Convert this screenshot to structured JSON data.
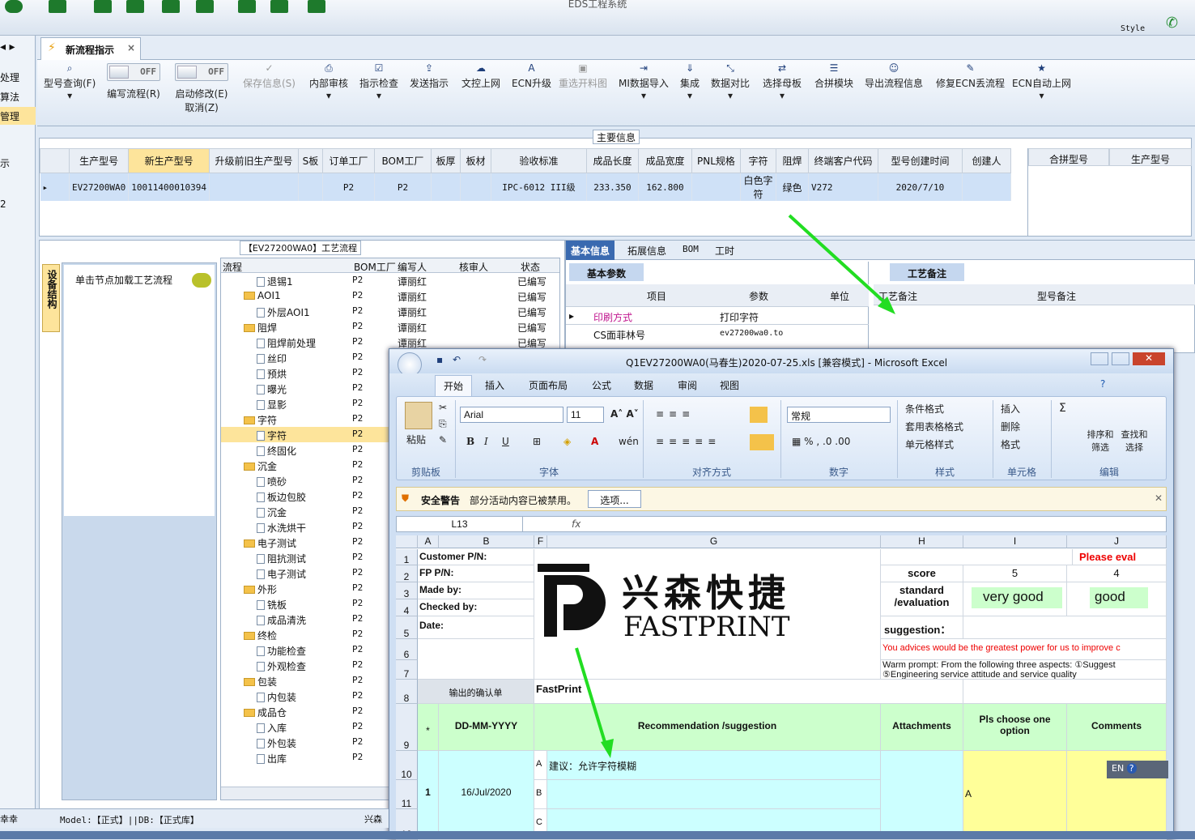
{
  "app": {
    "title": "EDS工程系统",
    "style_label": "Style"
  },
  "tab": {
    "label": "新流程指示",
    "close": "×"
  },
  "left_nav": [
    "处理",
    "算法",
    "管理",
    "示",
    "2"
  ],
  "ribbon": {
    "query": "型号查询(F)",
    "edit_flow": "编写流程(R)",
    "toggle_off": "OFF",
    "start_edit": "启动修改(E)",
    "cancel": "取消(Z)",
    "save": "保存信息(S)",
    "internal_review": "内部审核",
    "indicator_check": "指示检查",
    "send": "发送指示",
    "doc_upload": "文控上网",
    "ecn_upgrade": "ECN升级",
    "reselect": "重选开料图",
    "mi_import": "MI数据导入",
    "integrate": "集成",
    "compare": "数据对比",
    "select_mother": "选择母板",
    "merge_module": "合拼模块",
    "export_flow": "导出流程信息",
    "fix_ecn": "修复ECN丢流程",
    "ecn_auto": "ECN自动上网"
  },
  "main_info": {
    "title": "主要信息",
    "headers": [
      "生产型号",
      "新生产型号",
      "升级前旧生产型号",
      "S板",
      "订单工厂",
      "BOM工厂",
      "板厚",
      "板材",
      "验收标准",
      "成品长度",
      "成品宽度",
      "PNL规格",
      "字符",
      "阻焊",
      "终端客户代码",
      "型号创建时间",
      "创建人"
    ],
    "row": {
      "prod": "EV27200WA0",
      "new": "10011400010394",
      "order_factory": "P2",
      "bom": "P2",
      "standard": "IPC-6012 III级",
      "length": "233.350",
      "width": "162.800",
      "char": "白色字符",
      "solder": "绿色",
      "customer": "V272",
      "created": "2020/7/10"
    },
    "side_headers": [
      "合拼型号",
      "生产型号"
    ]
  },
  "process": {
    "title": "【EV27200WA0】工艺流程",
    "vtab": "设备结构",
    "node_hint": "单击节点加载工艺流程",
    "headers": [
      "流程",
      "BOM工厂",
      "编写人",
      "核审人",
      "状态"
    ],
    "rows": [
      {
        "n": "退锡1",
        "t": "doc",
        "l": 2,
        "b": "P2",
        "w": "谭丽红",
        "s": "已编写"
      },
      {
        "n": "AOI1",
        "t": "fold",
        "l": 1,
        "b": "P2",
        "w": "谭丽红",
        "s": "已编写"
      },
      {
        "n": "外层AOI1",
        "t": "doc",
        "l": 2,
        "b": "P2",
        "w": "谭丽红",
        "s": "已编写"
      },
      {
        "n": "阻焊",
        "t": "fold",
        "l": 1,
        "b": "P2",
        "w": "谭丽红",
        "s": "已编写"
      },
      {
        "n": "阻焊前处理",
        "t": "doc",
        "l": 2,
        "b": "P2",
        "w": "谭丽红",
        "s": "已编写"
      },
      {
        "n": "丝印",
        "t": "doc",
        "l": 2,
        "b": "P2",
        "w": "",
        "s": ""
      },
      {
        "n": "预烘",
        "t": "doc",
        "l": 2,
        "b": "P2",
        "w": "",
        "s": ""
      },
      {
        "n": "曝光",
        "t": "doc",
        "l": 2,
        "b": "P2",
        "w": "",
        "s": ""
      },
      {
        "n": "显影",
        "t": "doc",
        "l": 2,
        "b": "P2",
        "w": "",
        "s": ""
      },
      {
        "n": "字符",
        "t": "fold",
        "l": 1,
        "b": "P2",
        "w": "",
        "s": ""
      },
      {
        "n": "字符",
        "t": "doc",
        "l": 2,
        "b": "P2",
        "w": "",
        "s": "",
        "sel": true
      },
      {
        "n": "终固化",
        "t": "doc",
        "l": 2,
        "b": "P2",
        "w": "",
        "s": ""
      },
      {
        "n": "沉金",
        "t": "fold",
        "l": 1,
        "b": "P2",
        "w": "",
        "s": ""
      },
      {
        "n": "喷砂",
        "t": "doc",
        "l": 2,
        "b": "P2",
        "w": "",
        "s": ""
      },
      {
        "n": "板边包胶",
        "t": "doc",
        "l": 2,
        "b": "P2",
        "w": "",
        "s": ""
      },
      {
        "n": "沉金",
        "t": "doc",
        "l": 2,
        "b": "P2",
        "w": "",
        "s": ""
      },
      {
        "n": "水洗烘干",
        "t": "doc",
        "l": 2,
        "b": "P2",
        "w": "",
        "s": ""
      },
      {
        "n": "电子测试",
        "t": "fold",
        "l": 1,
        "b": "P2",
        "w": "",
        "s": ""
      },
      {
        "n": "阻抗测试",
        "t": "doc",
        "l": 2,
        "b": "P2",
        "w": "",
        "s": ""
      },
      {
        "n": "电子测试",
        "t": "doc",
        "l": 2,
        "b": "P2",
        "w": "",
        "s": ""
      },
      {
        "n": "外形",
        "t": "fold",
        "l": 1,
        "b": "P2",
        "w": "",
        "s": ""
      },
      {
        "n": "铣板",
        "t": "doc",
        "l": 2,
        "b": "P2",
        "w": "",
        "s": ""
      },
      {
        "n": "成品清洗",
        "t": "doc",
        "l": 2,
        "b": "P2",
        "w": "",
        "s": ""
      },
      {
        "n": "终检",
        "t": "fold",
        "l": 1,
        "b": "P2",
        "w": "",
        "s": ""
      },
      {
        "n": "功能检查",
        "t": "doc",
        "l": 2,
        "b": "P2",
        "w": "",
        "s": ""
      },
      {
        "n": "外观检查",
        "t": "doc",
        "l": 2,
        "b": "P2",
        "w": "",
        "s": ""
      },
      {
        "n": "包装",
        "t": "fold",
        "l": 1,
        "b": "P2",
        "w": "",
        "s": ""
      },
      {
        "n": "内包装",
        "t": "doc",
        "l": 2,
        "b": "P2",
        "w": "",
        "s": ""
      },
      {
        "n": "成品仓",
        "t": "fold",
        "l": 1,
        "b": "P2",
        "w": "",
        "s": ""
      },
      {
        "n": "入库",
        "t": "doc",
        "l": 2,
        "b": "P2",
        "w": "",
        "s": ""
      },
      {
        "n": "外包装",
        "t": "doc",
        "l": 2,
        "b": "P2",
        "w": "",
        "s": ""
      },
      {
        "n": "出库",
        "t": "doc",
        "l": 2,
        "b": "P2",
        "w": "",
        "s": ""
      }
    ]
  },
  "right_panel": {
    "tabs": [
      "基本信息",
      "拓展信息",
      "BOM",
      "工时"
    ],
    "basic_params": "基本参数",
    "craft_note": "工艺备注",
    "headers": [
      "项目",
      "参数",
      "单位"
    ],
    "rows": [
      [
        "印刷方式",
        "打印字符"
      ],
      [
        "CS面菲林号",
        "ev27200wa0.to"
      ]
    ],
    "note_headers": [
      "工艺备注",
      "型号备注"
    ]
  },
  "excel": {
    "title": "Q1EV27200WA0(马春生)2020-07-25.xls  [兼容模式] - Microsoft Excel",
    "tabs": [
      "开始",
      "插入",
      "页面布局",
      "公式",
      "数据",
      "审阅",
      "视图"
    ],
    "font": "Arial",
    "size": "11",
    "number_format": "常规",
    "groups": [
      "剪贴板",
      "字体",
      "对齐方式",
      "数字",
      "样式",
      "单元格",
      "编辑"
    ],
    "paste": "粘贴",
    "style_btns": [
      "条件格式",
      "套用表格格式",
      "单元格样式"
    ],
    "cell_btns": [
      "插入",
      "删除",
      "格式"
    ],
    "edit_btns": [
      "排序和筛选",
      "查找和选择"
    ],
    "warning": {
      "title": "安全警告",
      "text": "部分活动内容已被禁用。",
      "button": "选项..."
    },
    "name_box": "L13",
    "fx": "fx",
    "cols": [
      "A",
      "B",
      "F",
      "G",
      "H",
      "I",
      "J"
    ],
    "sheet": {
      "customer": "Customer P/N:",
      "fp": "FP P/N:",
      "made": "Made by:",
      "checked": "Checked by:",
      "date": "Date:",
      "please": "Please eval",
      "score": "score",
      "s5": "5",
      "s4": "4",
      "standard": "standard\n/evaluation",
      "very_good": "very good",
      "good": "good",
      "suggestion": "suggestion：",
      "advice": "You advices would be the greatest power for us to improve c",
      "warm": "Warm prompt:  From the following three aspects: ①Suggest",
      "warm2": "⑤Engineering service attitude and service quality",
      "output": "输出的确认单",
      "fastprint": "FastPrint",
      "h_star": "*",
      "h_date": "DD-MM-YYYY",
      "h_rec": "Recommendation /suggestion",
      "h_att": "Attachments",
      "h_pls": "Pls choose one option",
      "h_com": "Comments",
      "no1": "1",
      "d1": "16/Jul/2020",
      "ra": "A",
      "rb": "B",
      "rc": "C",
      "sug": "建议：允许字符模糊",
      "choice": "A",
      "logo_cn": "兴森快捷",
      "logo_en": "FASTPRINT"
    },
    "ime": "EN"
  },
  "status": {
    "left": "幸幸",
    "model": "Model:【正式】||DB:【正式库】",
    "right": "兴森"
  }
}
